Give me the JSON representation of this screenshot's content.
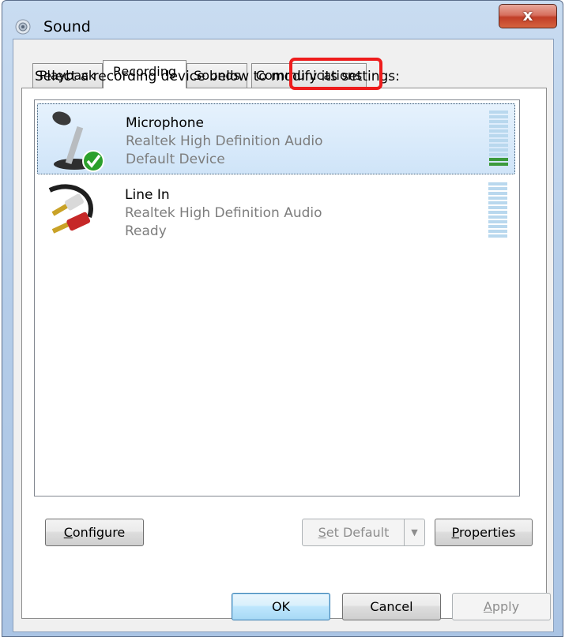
{
  "window": {
    "title": "Sound",
    "close_label": "x"
  },
  "tabs": [
    {
      "label": "Playback",
      "active": false
    },
    {
      "label": "Recording",
      "active": true
    },
    {
      "label": "Sounds",
      "active": false
    },
    {
      "label": "Communications",
      "active": false
    }
  ],
  "instruction": "Select a recording device below to modify its settings:",
  "devices": [
    {
      "name": "Microphone",
      "driver": "Realtek High Definition Audio",
      "status": "Default Device",
      "icon": "microphone-icon",
      "selected": true,
      "is_default": true,
      "level_fraction": 0.2
    },
    {
      "name": "Line In",
      "driver": "Realtek High Definition Audio",
      "status": "Ready",
      "icon": "rca-cable-icon",
      "selected": false,
      "is_default": false,
      "level_fraction": 0.0
    }
  ],
  "buttons": {
    "configure": {
      "prefix": "",
      "mnemonic": "C",
      "rest": "onfigure"
    },
    "set_default": {
      "prefix": "",
      "mnemonic": "S",
      "rest": "et Default",
      "enabled": false
    },
    "properties": {
      "prefix": "",
      "mnemonic": "P",
      "rest": "roperties"
    },
    "ok": "OK",
    "cancel": "Cancel",
    "apply": {
      "prefix": "",
      "mnemonic": "A",
      "rest": "pply",
      "enabled": false
    }
  },
  "colors": {
    "highlight": "#ee1c1c",
    "level_on": "#3c9a3c",
    "level_off": "#b9d8ee",
    "close": "#c13e27"
  }
}
